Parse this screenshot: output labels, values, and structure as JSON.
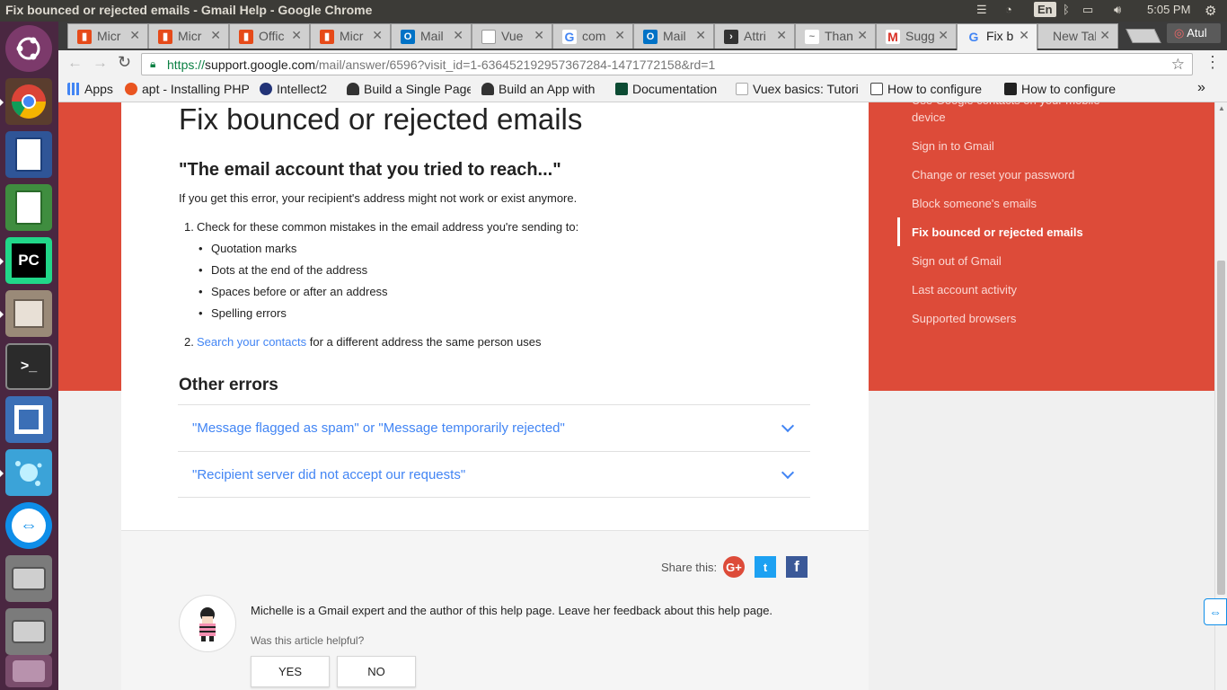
{
  "window": {
    "title": "Fix bounced or rejected emails - Gmail Help - Google Chrome"
  },
  "tray": {
    "lang": "En",
    "time": "5:05 PM",
    "user_chip": "Atul"
  },
  "tabs": [
    {
      "label": "Micr",
      "icon": "office-icon",
      "color": "#e64a19"
    },
    {
      "label": "Micr",
      "icon": "office-icon",
      "color": "#e64a19"
    },
    {
      "label": "Offic",
      "icon": "office-icon",
      "color": "#e64a19"
    },
    {
      "label": "Micr",
      "icon": "office-icon",
      "color": "#e64a19"
    },
    {
      "label": "Mail",
      "icon": "outlook-icon",
      "color": "#0072c6"
    },
    {
      "label": "Vue",
      "icon": "page-icon",
      "color": "#999999"
    },
    {
      "label": "com",
      "icon": "google-icon",
      "color": "#4285f4"
    },
    {
      "label": "Mail",
      "icon": "outlook-icon",
      "color": "#0072c6"
    },
    {
      "label": "Attri",
      "icon": "terminal-icon",
      "color": "#333333"
    },
    {
      "label": "Than",
      "icon": "wave-icon",
      "color": "#888888"
    },
    {
      "label": "Sugg",
      "icon": "gmail-icon",
      "color": "#d93025"
    },
    {
      "label": "Fix b",
      "icon": "google-icon",
      "color": "#4285f4"
    },
    {
      "label": "New Tab",
      "icon": "none",
      "color": "#d0d0d0"
    }
  ],
  "address": {
    "scheme": "https://",
    "host": "support.google.com",
    "path": "/mail/answer/6596?visit_id=1-636452192957367284-1471772158&rd=1"
  },
  "bookmarks": [
    {
      "label": "Apps",
      "icon": "apps-grid-icon",
      "color": "#4285f4"
    },
    {
      "label": "apt - Installing PHP",
      "icon": "askubuntu-icon",
      "color": "#e95420"
    },
    {
      "label": "Intellect2",
      "icon": "intellect-icon",
      "color": "#223377"
    },
    {
      "label": "Build a Single Page",
      "icon": "tux-icon",
      "color": "#333333"
    },
    {
      "label": "Build an App with",
      "icon": "tux-icon",
      "color": "#333333"
    },
    {
      "label": "Documentation",
      "icon": "django-icon",
      "color": "#0c4b33"
    },
    {
      "label": "Vuex basics: Tutori",
      "icon": "page-icon",
      "color": "#aaaaaa"
    },
    {
      "label": "How to configure",
      "icon": "bracket-icon",
      "color": "#444444"
    },
    {
      "label": "How to configure",
      "icon": "terminal-icon",
      "color": "#222222"
    }
  ],
  "article": {
    "title": "Fix bounced or rejected emails",
    "section_title": "\"The email account that you tried to reach...\"",
    "intro": "If you get this error, your recipient's address might not work or exist anymore.",
    "step1": "Check for these common mistakes in the email address you're sending to:",
    "bullets": [
      "Quotation marks",
      "Dots at the end of the address",
      "Spaces before or after an address",
      "Spelling errors"
    ],
    "step2_link": "Search your contacts",
    "step2_rest": " for a different address the same person uses",
    "other_title": "Other errors",
    "accordion": [
      "\"Message flagged as spam\" or \"Message temporarily rejected\"",
      "\"Recipient server did not accept our requests\""
    ]
  },
  "sidenav": {
    "partial": "device",
    "items": [
      "Sign in to Gmail",
      "Change or reset your password",
      "Block someone's emails",
      "Fix bounced or rejected emails",
      "Sign out of Gmail",
      "Last account activity",
      "Supported browsers"
    ],
    "current": "Fix bounced or rejected emails"
  },
  "footer": {
    "share_label": "Share this:",
    "share_icons": [
      "google-plus-icon",
      "twitter-icon",
      "facebook-icon"
    ],
    "author_note": "Michelle is a Gmail expert and the author of this help page. Leave her feedback about this help page.",
    "helpful_q": "Was this article helpful?",
    "yes": "YES",
    "no": "NO"
  },
  "colors": {
    "brand_red": "#dd4b39",
    "link_blue": "#4285f4"
  }
}
